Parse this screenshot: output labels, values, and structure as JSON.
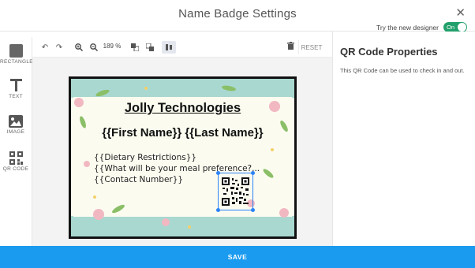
{
  "header": {
    "title": "Name Badge Settings",
    "new_designer_label": "Try the new designer",
    "toggle_label": "On"
  },
  "tools": [
    {
      "label": "RECTANGLE",
      "icon": "rectangle-icon"
    },
    {
      "label": "TEXT",
      "icon": "text-icon"
    },
    {
      "label": "IMAGE",
      "icon": "image-icon"
    },
    {
      "label": "QR CODE",
      "icon": "qr-code-icon"
    }
  ],
  "toolbar": {
    "zoom": "189 %",
    "reset_label": "RESET",
    "icons": [
      "undo-icon",
      "redo-icon",
      "zoom-in-icon",
      "zoom-out-icon",
      "send-backward-icon",
      "bring-forward-icon",
      "align-icon",
      "trash-icon"
    ]
  },
  "badge": {
    "company": "Jolly Technologies",
    "full_name": "{{First Name}} {{Last Name}}",
    "fields": [
      "{{Dietary Restrictions}}",
      "{{What will be your meal preference?...",
      "{{Contact Number}}"
    ],
    "colors": {
      "strip": "#a8d8d0",
      "background": "#fbfbf0",
      "border": "#111111"
    }
  },
  "panel": {
    "title": "QR Code Properties",
    "description": "This QR Code can be used to check in and out."
  },
  "save_label": "SAVE",
  "colors": {
    "accent": "#1a9bef",
    "toggle": "#22a06b",
    "selection": "#2b83f6"
  }
}
